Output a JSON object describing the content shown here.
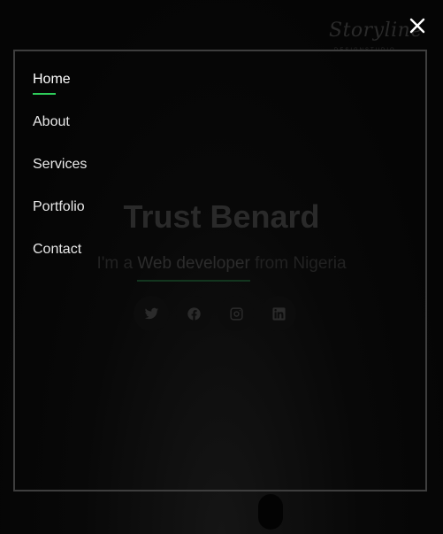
{
  "background": {
    "logo_text": "Storyline",
    "logo_subtext": "DESIGNSTUDIO",
    "hero_title": "Trust Benard",
    "hero_prefix": "I'm a",
    "hero_highlight": "Web developer",
    "hero_suffix": "from Nigeria",
    "socials": [
      "twitter-icon",
      "facebook-icon",
      "instagram-icon",
      "linkedin-icon"
    ]
  },
  "menu": {
    "items": [
      {
        "label": "Home",
        "active": true
      },
      {
        "label": "About",
        "active": false
      },
      {
        "label": "Services",
        "active": false
      },
      {
        "label": "Portfolio",
        "active": false
      },
      {
        "label": "Contact",
        "active": false
      }
    ],
    "close_icon": "close-icon"
  },
  "colors": {
    "accent": "#2ecc5a",
    "border": "#3e3e3e",
    "background": "#050505"
  }
}
